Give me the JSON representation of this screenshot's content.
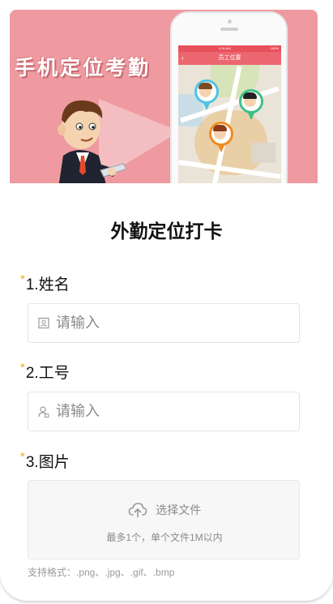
{
  "banner": {
    "title": "手机定位考勤",
    "phone_nav_title": "员工位置",
    "phone_status_time": "9:30 AM",
    "phone_status_battery": "100%",
    "colors": {
      "background": "#ef9aa0",
      "nav": "#ec6670"
    }
  },
  "page_title": "外勤定位打卡",
  "fields": [
    {
      "number": "1.",
      "label": "姓名",
      "required_mark": "*",
      "placeholder": "请输入",
      "icon": "id-card-icon"
    },
    {
      "number": "2.",
      "label": "工号",
      "required_mark": "*",
      "placeholder": "请输入",
      "icon": "user-badge-icon"
    },
    {
      "number": "3.",
      "label": "图片",
      "required_mark": "*"
    }
  ],
  "upload": {
    "icon": "cloud-upload-icon",
    "label": "选择文件",
    "hint": "最多1个，单个文件1M以内",
    "formats_note": "支持格式：.png、.jpg、.gif、.bmp"
  },
  "colors": {
    "required": "#f5a623",
    "placeholder": "#8a8a8a"
  }
}
